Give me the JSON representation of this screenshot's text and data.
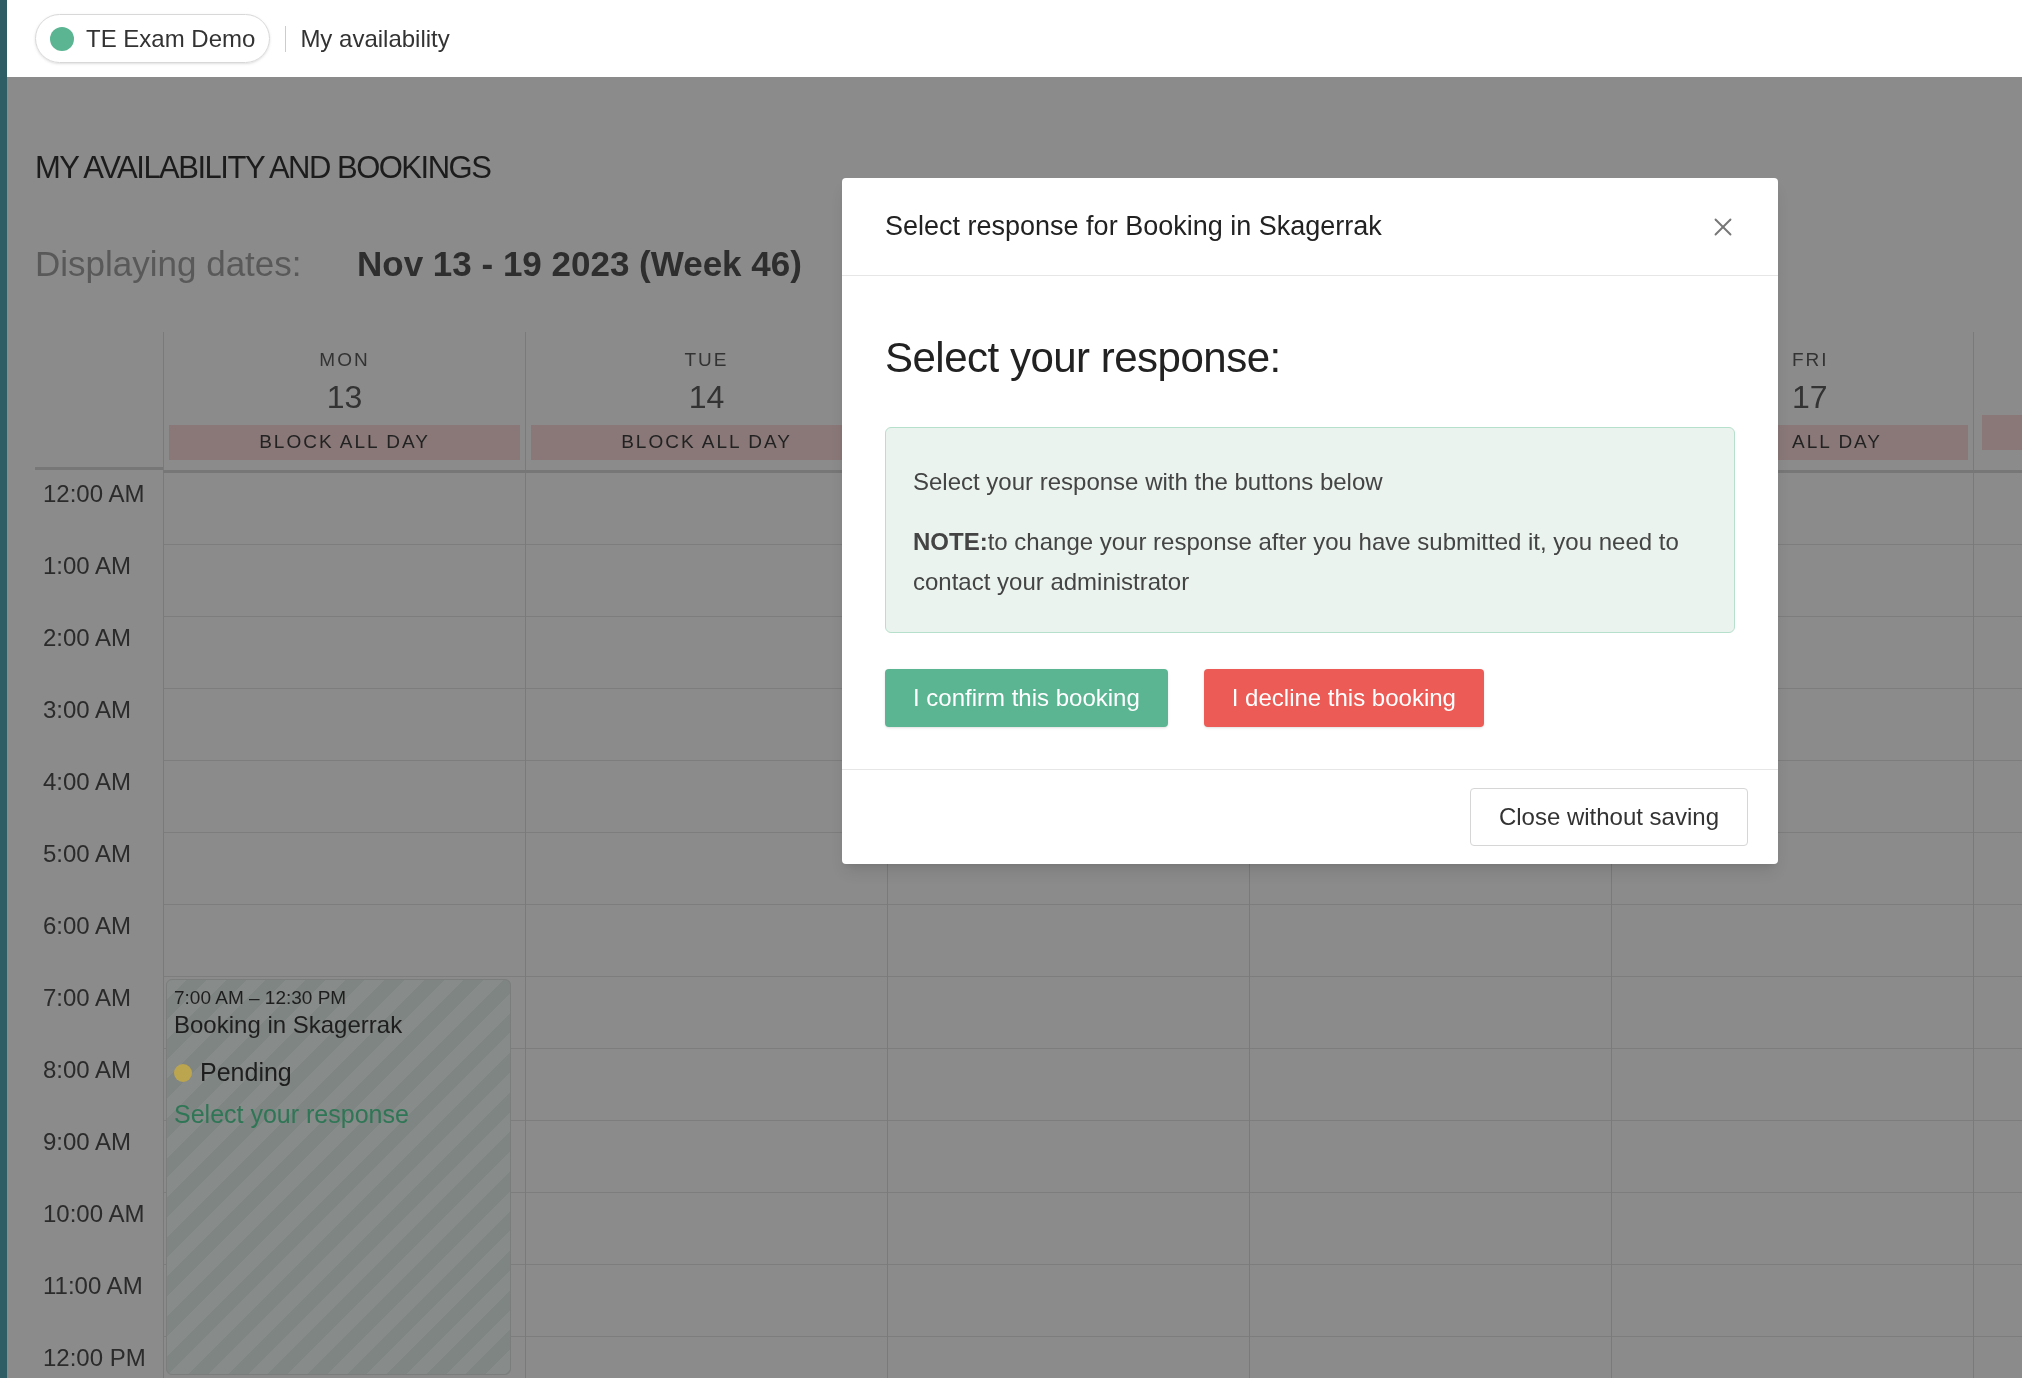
{
  "top_bar": {
    "org": {
      "name": "TE Exam Demo"
    },
    "breadcrumb": "My availability"
  },
  "page": {
    "title": "MY AVAILABILITY AND BOOKINGS",
    "dates_label": "Displaying dates:",
    "dates_value": "Nov 13 - 19 2023 (Week 46)"
  },
  "calendar": {
    "days": [
      {
        "kind": "full",
        "weekday": "MON",
        "date": "13",
        "block_label": "BLOCK ALL DAY",
        "events": [
          {
            "time": "7:00 AM – 12:30 PM",
            "title": "Booking in Skagerrak",
            "status": {
              "label": "Pending",
              "color": "#bca54f"
            },
            "link": "Select your response"
          }
        ]
      },
      {
        "kind": "full",
        "weekday": "TUE",
        "date": "14",
        "block_label": "BLOCK ALL DAY"
      },
      {
        "kind": "covered"
      },
      {
        "kind": "covered"
      },
      {
        "kind": "clipped",
        "weekday": "FRI",
        "date": "17",
        "block_label": "ALL DAY"
      },
      {
        "kind": "edge"
      }
    ],
    "time_labels": [
      "12:00 AM",
      "1:00 AM",
      "2:00 AM",
      "3:00 AM",
      "4:00 AM",
      "5:00 AM",
      "6:00 AM",
      "7:00 AM",
      "8:00 AM",
      "9:00 AM",
      "10:00 AM",
      "11:00 AM",
      "12:00 PM"
    ]
  },
  "modal": {
    "title": "Select response for Booking in Skagerrak",
    "heading": "Select your response:",
    "info": [
      "Select your response with the buttons below",
      "**NOTE:**to change your response after you have submitted it, you need to contact your administrator"
    ],
    "actions": [
      {
        "kind": "confirm",
        "label": "I confirm this booking"
      },
      {
        "kind": "decline",
        "label": "I decline this booking"
      }
    ],
    "footer_button": "Close without saving"
  }
}
